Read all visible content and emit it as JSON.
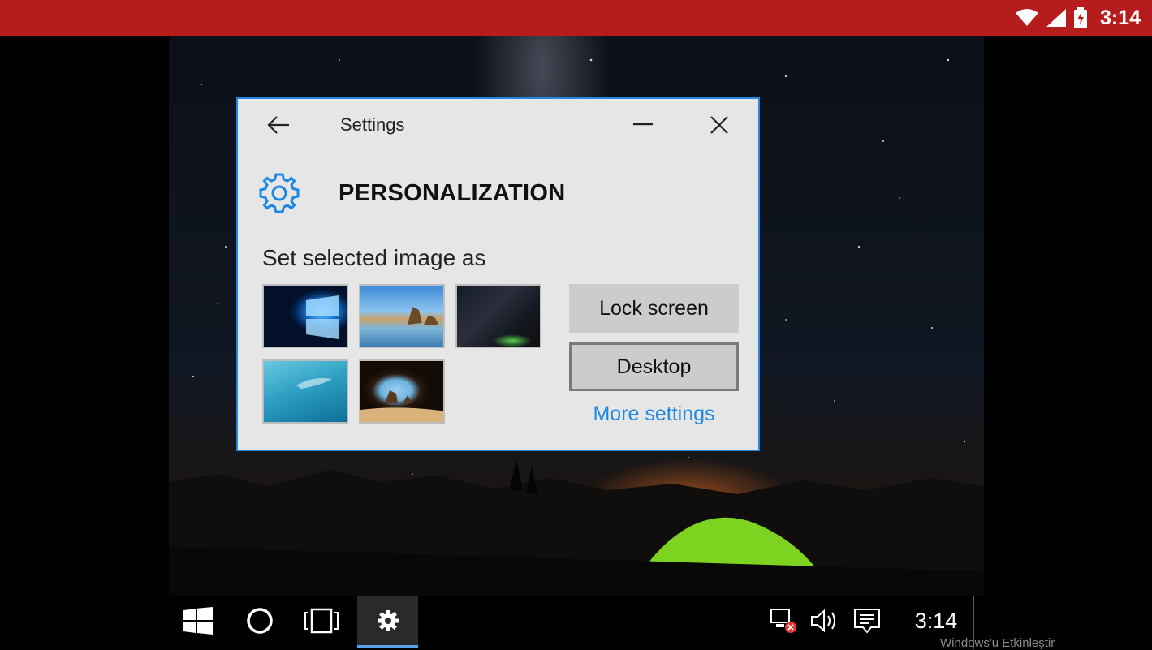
{
  "android_status": {
    "clock": "3:14",
    "icons": [
      "wifi-icon",
      "cell-signal-icon",
      "battery-charging-icon"
    ]
  },
  "window": {
    "title": "Settings",
    "heading": "PERSONALIZATION",
    "prompt": "Set selected image as",
    "thumbnails": [
      {
        "name": "windows-logo-wallpaper"
      },
      {
        "name": "beach-rocks-wallpaper"
      },
      {
        "name": "milky-way-tent-wallpaper"
      },
      {
        "name": "underwater-swimmer-wallpaper"
      },
      {
        "name": "sea-cave-wallpaper"
      }
    ],
    "buttons": {
      "lock_screen": "Lock screen",
      "desktop": "Desktop",
      "more_settings": "More settings"
    },
    "accent": "#1e88e5"
  },
  "taskbar": {
    "clock": "3:14",
    "active_item": "settings"
  },
  "watermark": "Windows'u Etkinleştir"
}
